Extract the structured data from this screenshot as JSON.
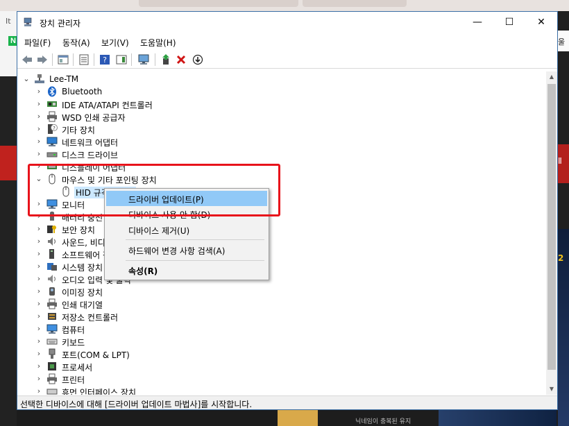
{
  "background": {
    "left_letters": "It",
    "left_badge": "N",
    "right_text_top": "울",
    "right_text_mid": "Ⅱ",
    "right_text_low": "2",
    "bottom_caption": "닉네임이 충복된 유지"
  },
  "window": {
    "title": "장치 관리자",
    "controls": {
      "minimize": "—",
      "maximize": "☐",
      "close": "✕"
    }
  },
  "menu": [
    "파일(F)",
    "동작(A)",
    "보기(V)",
    "도움말(H)"
  ],
  "tree": {
    "root": "Lee-TM",
    "items": [
      {
        "label": "Bluetooth",
        "icon": "bluetooth-icon"
      },
      {
        "label": "IDE ATA/ATAPI 컨트롤러",
        "icon": "ide-controller-icon"
      },
      {
        "label": "WSD 인쇄 공급자",
        "icon": "printer-icon"
      },
      {
        "label": "기타 장치",
        "icon": "unknown-device-icon"
      },
      {
        "label": "네트워크 어댑터",
        "icon": "network-adapter-icon"
      },
      {
        "label": "디스크 드라이브",
        "icon": "disk-drive-icon"
      },
      {
        "label": "디스플레이 어댑터",
        "icon": "display-adapter-icon"
      },
      {
        "label": "마우스 및 기타 포인팅 장치",
        "icon": "mouse-icon",
        "expanded": true
      },
      {
        "label": "HID 규격 마우스",
        "icon": "mouse-icon",
        "child": true
      },
      {
        "label": "모니터",
        "icon": "monitor-icon"
      },
      {
        "label": "배터리 충전",
        "icon": "battery-icon"
      },
      {
        "label": "보안 장치",
        "icon": "security-device-icon"
      },
      {
        "label": "사운드, 비디오 및 게임 컨트롤러",
        "icon": "sound-icon"
      },
      {
        "label": "소프트웨어 장치",
        "icon": "software-device-icon"
      },
      {
        "label": "시스템 장치",
        "icon": "system-device-icon"
      },
      {
        "label": "오디오 입력 및 출력",
        "icon": "audio-icon"
      },
      {
        "label": "이미징 장치",
        "icon": "camera-icon"
      },
      {
        "label": "인쇄 대기열",
        "icon": "print-queue-icon"
      },
      {
        "label": "저장소 컨트롤러",
        "icon": "storage-controller-icon"
      },
      {
        "label": "컴퓨터",
        "icon": "computer-icon"
      },
      {
        "label": "키보드",
        "icon": "keyboard-icon"
      },
      {
        "label": "포트(COM & LPT)",
        "icon": "port-icon"
      },
      {
        "label": "프로세서",
        "icon": "processor-icon"
      },
      {
        "label": "프린터",
        "icon": "printer-icon"
      },
      {
        "label": "휴먼 인터페이스 장치",
        "icon": "hid-icon"
      }
    ]
  },
  "context_menu": {
    "update_driver": "드라이버 업데이트(P)",
    "disable_device": "디바이스 사용 안 함(D)",
    "uninstall_device": "디바이스 제거(U)",
    "scan_hardware": "하드웨어 변경 사항 검색(A)",
    "properties": "속성(R)"
  },
  "status": "선택한 디바이스에 대해 [드라이버 업데이트 마법사]를 시작합니다.",
  "colors": {
    "highlight": "#91c9f7",
    "annotation": "#e8131b",
    "window_border": "#3a6ea5"
  }
}
